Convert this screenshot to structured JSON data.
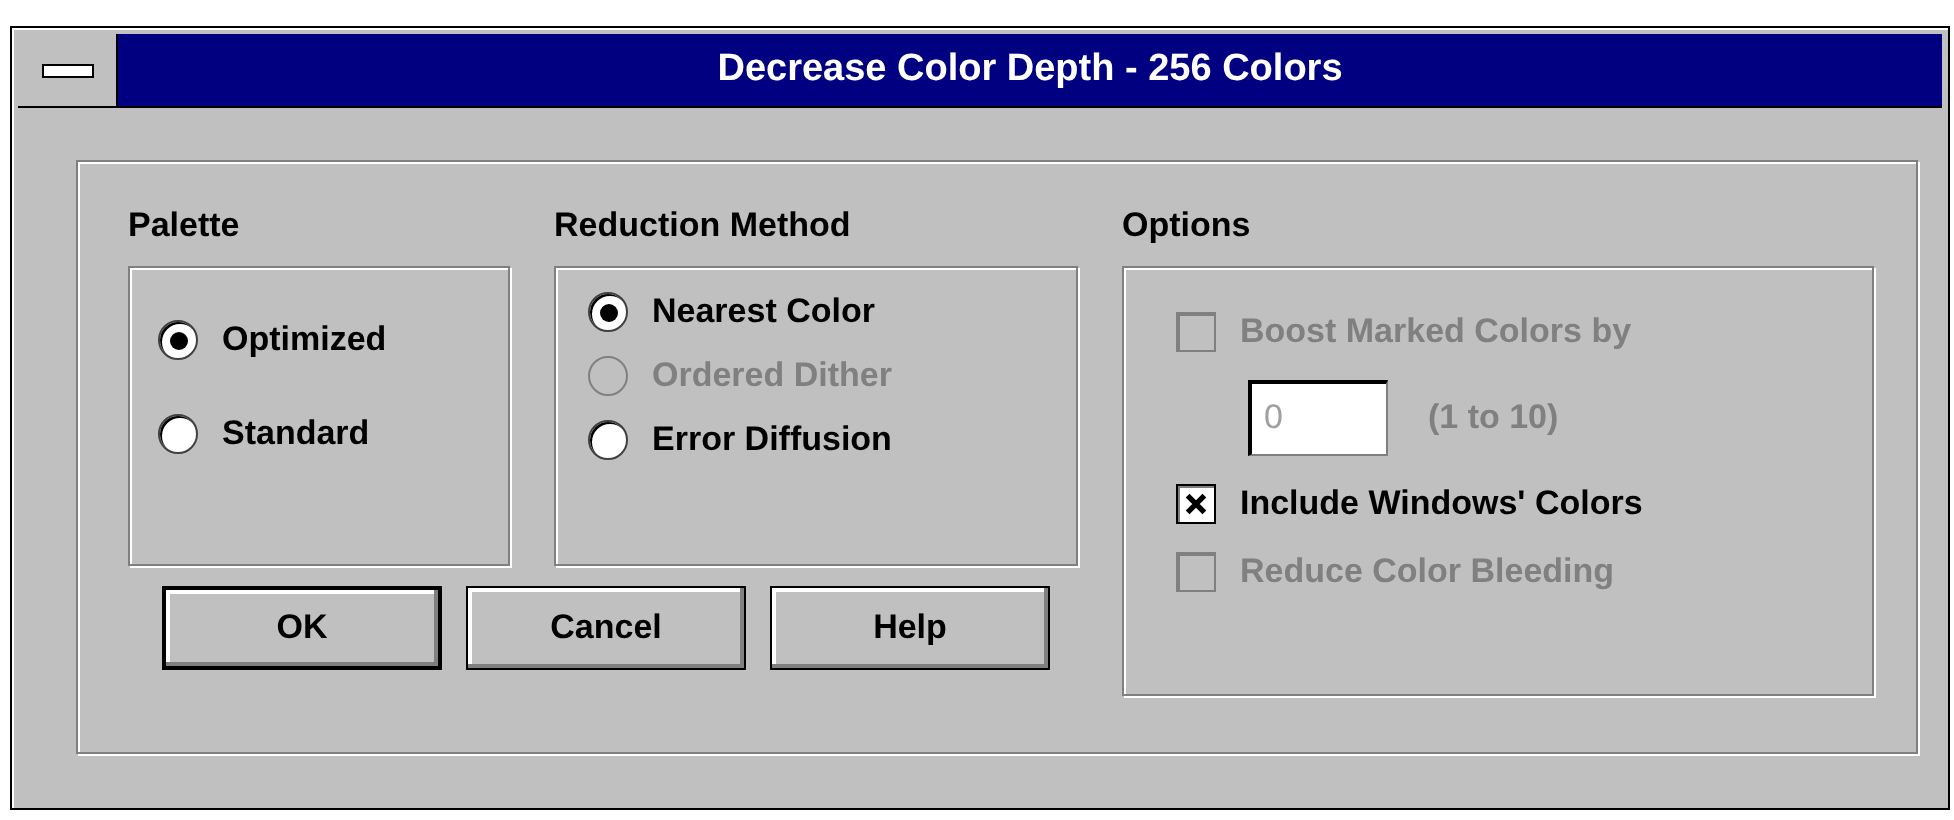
{
  "window": {
    "title": "Decrease Color Depth - 256 Colors"
  },
  "palette": {
    "label": "Palette",
    "options": [
      {
        "label": "Optimized",
        "selected": true,
        "disabled": false
      },
      {
        "label": "Standard",
        "selected": false,
        "disabled": false
      }
    ]
  },
  "reduction_method": {
    "label": "Reduction Method",
    "options": [
      {
        "label": "Nearest Color",
        "selected": true,
        "disabled": false
      },
      {
        "label": "Ordered Dither",
        "selected": false,
        "disabled": true
      },
      {
        "label": "Error Diffusion",
        "selected": false,
        "disabled": false
      }
    ]
  },
  "options": {
    "label": "Options",
    "items": [
      {
        "kind": "checkbox",
        "label": "Boost Marked Colors by",
        "checked": false,
        "disabled": true
      },
      {
        "kind": "field",
        "value": "0",
        "hint": "(1 to 10)",
        "disabled": true
      },
      {
        "kind": "checkbox",
        "label": "Include Windows' Colors",
        "checked": true,
        "disabled": false
      },
      {
        "kind": "checkbox",
        "label": "Reduce Color Bleeding",
        "checked": false,
        "disabled": true
      }
    ]
  },
  "buttons": [
    {
      "label": "OK",
      "default": true
    },
    {
      "label": "Cancel",
      "default": false
    },
    {
      "label": "Help",
      "default": false
    }
  ]
}
